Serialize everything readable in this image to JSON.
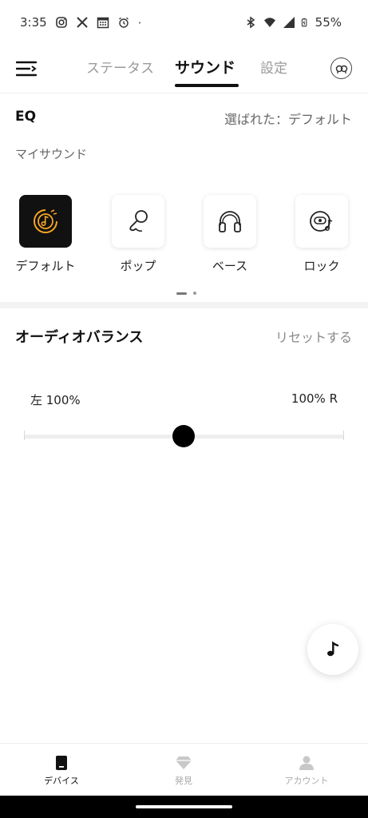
{
  "status_bar": {
    "time": "3:35",
    "battery": "55%",
    "left_icons": [
      "instagram-icon",
      "x-icon",
      "calendar-icon",
      "alarm-icon",
      "dot-icon"
    ],
    "right_icons": [
      "bluetooth-icon",
      "wifi-icon",
      "signal-icon",
      "battery-icon"
    ]
  },
  "top_nav": {
    "tabs": [
      {
        "label": "ステータス",
        "active": false
      },
      {
        "label": "サウンド",
        "active": true
      },
      {
        "label": "設定",
        "active": false
      }
    ]
  },
  "eq": {
    "title": "EQ",
    "selected_text": "選ばれた：デフォルト",
    "my_sound_label": "マイサウンド",
    "presets": [
      {
        "label": "デフォルト",
        "icon": "music-disc-icon",
        "selected": true
      },
      {
        "label": "ポップ",
        "icon": "microphone-icon",
        "selected": false
      },
      {
        "label": "ベース",
        "icon": "headphones-icon",
        "selected": false
      },
      {
        "label": "ロック",
        "icon": "rock-record-icon",
        "selected": false
      }
    ],
    "accent_color": "#F5A623"
  },
  "audio_balance": {
    "title": "オーディオバランス",
    "reset_label": "リセットする",
    "left_label": "左 100%",
    "right_label": "100% R",
    "balance_value": 0
  },
  "bottom_nav": {
    "items": [
      {
        "label": "デバイス",
        "icon": "device-icon",
        "active": true
      },
      {
        "label": "発見",
        "icon": "diamond-icon",
        "active": false
      },
      {
        "label": "アカウント",
        "icon": "person-icon",
        "active": false
      }
    ]
  }
}
